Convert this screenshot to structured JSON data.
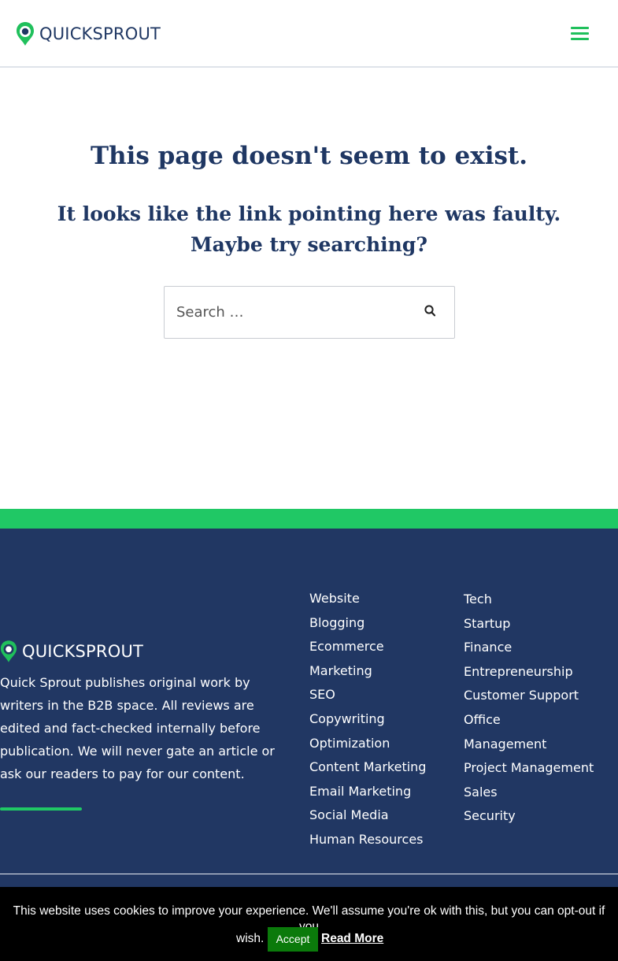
{
  "header": {
    "logo_text": "QUICKSPROUT",
    "menu_icon": "hamburger-menu-icon"
  },
  "main": {
    "title": "This page doesn't seem to exist.",
    "subtitle": "It looks like the link pointing here was faulty. Maybe try searching?",
    "search": {
      "placeholder": "Search …",
      "value": "",
      "icon": "search-icon"
    }
  },
  "footer": {
    "logo_text": "QUICKSPROUT",
    "description": "Quick Sprout publishes original work by writers in the B2B space. All reviews are edited and fact-checked internally before publication. We will never gate an article or ask our readers to pay for our content.",
    "column1": [
      "Website",
      "Blogging",
      "Ecommerce",
      "Marketing",
      "SEO",
      "Copywriting",
      "Optimization",
      "Content Marketing",
      "Email Marketing",
      "Social Media",
      "Human Resources"
    ],
    "column2": [
      "Tech",
      "Startup",
      "Finance",
      "Entrepreneurship",
      "Customer Support",
      "Office",
      "Management",
      "Project Management",
      "Sales",
      "Security"
    ]
  },
  "cookie": {
    "message": "This website uses cookies to improve your experience. We'll assume you're ok with this, but you can opt-out if you",
    "message_end": "wish.",
    "accept_label": "Accept",
    "read_more_label": "Read More"
  },
  "colors": {
    "brand_green": "#20c865",
    "brand_navy": "#1f3763",
    "footer_bg": "#213763",
    "accept_bg": "#0b7a0b"
  }
}
